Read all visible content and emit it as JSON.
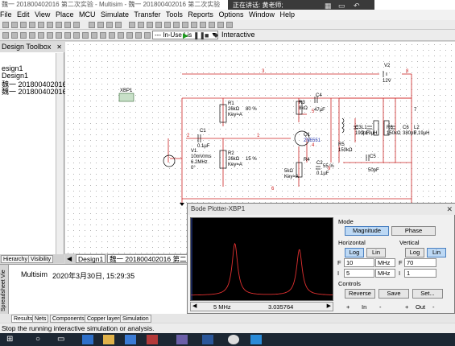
{
  "window": {
    "title": "魏一 201800402016 第二次实验 - Multisim - 魏一 201800402016 第二次实验",
    "speaker": "正在讲话: 黄老师;"
  },
  "menu": [
    "File",
    "Edit",
    "View",
    "Place",
    "MCU",
    "Simulate",
    "Transfer",
    "Tools",
    "Reports",
    "Options",
    "Window",
    "Help"
  ],
  "toolbar": {
    "in_use_list": "--- In-Use Lis",
    "interactive": "Interactive"
  },
  "toolbox": {
    "title": "Design Toolbox",
    "tree": [
      "esign1",
      "Design1",
      "魏一 201800402016 第",
      "魏一 201800402016"
    ],
    "tabs": [
      "Hierarchy",
      "Visibility"
    ]
  },
  "schematic": {
    "labels": {
      "xbp": "XBP1",
      "v2": "V2",
      "v2v": "12V",
      "r1": "R1",
      "r1v": "26kΩ",
      "r1k": "Key=A",
      "r1p": "80 %",
      "r3": "R3",
      "r3v": "8kΩ",
      "c4": "C4",
      "c4v": "47µF",
      "c1": "C1",
      "c1v": "0.1µF",
      "q1": "Q1",
      "q1v": "2N5551",
      "r2": "R2",
      "r2v": "26kΩ",
      "r2k": "Key=A",
      "r2p": "15 %",
      "v1": "V1",
      "v1a": "10mVrms",
      "v1b": "6.2MHz",
      "v1c": "0°",
      "r4": "R4",
      "r4v": "5kΩ",
      "r4k": "Key=A",
      "c2": "C2",
      "c2v": "0.1µF",
      "r4p": "55 %",
      "r5": "R5",
      "r5v": "150kΩ",
      "c3": "C3",
      "c3v": "190pF",
      "l1": "L1",
      "l1v": "2.19µH",
      "r6": "R6",
      "r6v": "150kΩ",
      "c6": "C6",
      "c6v": "380pF",
      "l2": "L2",
      "l2v": "2.19µH",
      "c5": "C5",
      "c5v": "50pF",
      "n1": "1",
      "n2": "2",
      "n3": "3",
      "n4": "4",
      "n5": "5",
      "n6": "6",
      "n7": "7",
      "n8": "8",
      "n9": "9"
    }
  },
  "design_tabs": [
    "Design1",
    "魏一 201800402016 第二次"
  ],
  "spreadsheet": {
    "side_label": "Spreadsheet Vie",
    "row_app": "Multisim",
    "row_time": "2020年3月30日, 15:29:35",
    "tabs": [
      "Results",
      "Nets",
      "Components",
      "Copper layers",
      "Simulation"
    ]
  },
  "status": "Stop the running interactive simulation or analysis.",
  "bode": {
    "title": "Bode Plotter-XBP1",
    "mode_label": "Mode",
    "magnitude": "Magnitude",
    "phase": "Phase",
    "horizontal_label": "Horizontal",
    "vertical_label": "Vertical",
    "log": "Log",
    "lin": "Lin",
    "h_f": "10",
    "h_f_unit": "MHz",
    "h_i": "5",
    "h_i_unit": "MHz",
    "v_f": "70",
    "v_i": "1",
    "f": "F",
    "i": "I",
    "controls_label": "Controls",
    "reverse": "Reverse",
    "save": "Save",
    "set": "Set...",
    "in_label": "In",
    "out_label": "Out",
    "plus": "+",
    "minus": "-",
    "readout_x": "5 MHz",
    "readout_y": "3.035764",
    "peaks": [
      {
        "x_mhz": 6.2,
        "level": 0.7
      },
      {
        "x_mhz": 8.5,
        "level": 0.62
      }
    ]
  }
}
